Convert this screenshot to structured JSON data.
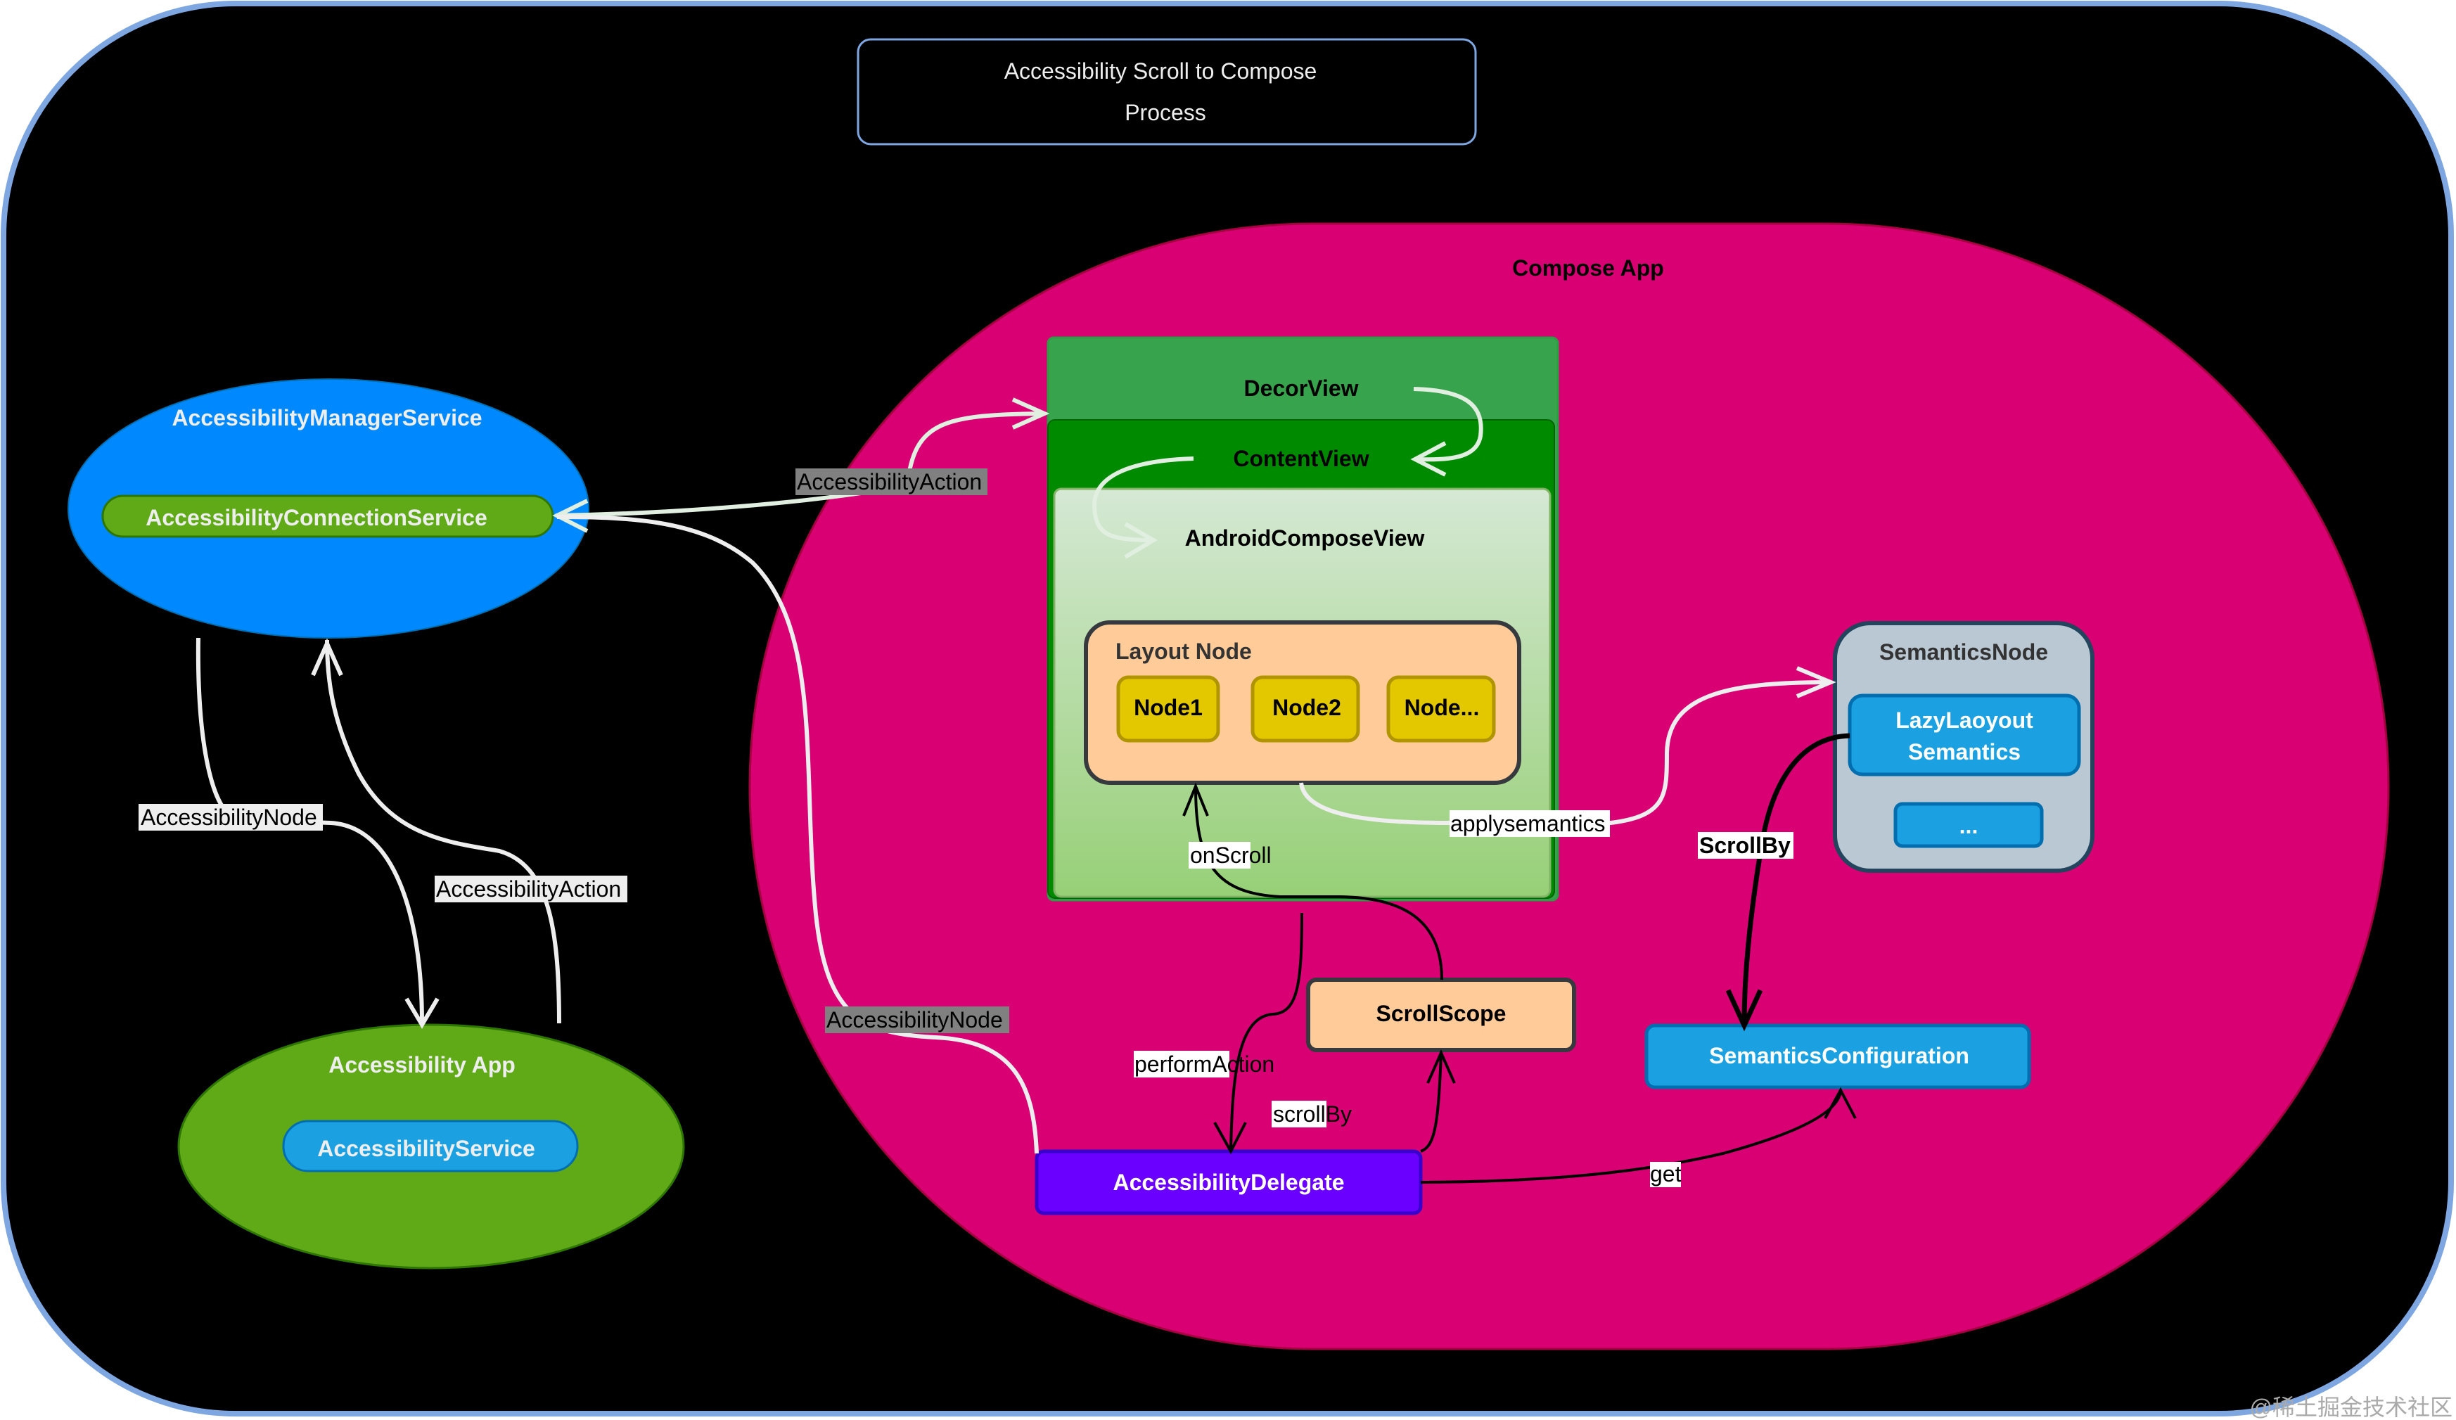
{
  "title": {
    "line1": "Accessibility Scroll to Compose",
    "line2": "Process"
  },
  "colors": {
    "background": "#000000",
    "frame_border": "#7ea6e0",
    "manager_fill": "#0088ff",
    "connection_fill": "#60a917",
    "app_fill": "#60a917",
    "service_fill": "#1ba1e2",
    "compose_fill": "#d80073",
    "decor_fill": "#37a34d",
    "content_fill": "#008a00",
    "compose_view_fill": "#c9e6c4",
    "layout_node_fill": "#ffcc99",
    "node_fill": "#e3c800",
    "semantics_fill": "#bac8d3",
    "delegate_fill": "#6a00ff",
    "label_gray_bg": "#808080"
  },
  "nodes": {
    "manager": {
      "title": "AccessibilityManagerService",
      "connection": "AccessibilityConnectionService"
    },
    "app": {
      "title": "Accessibility App",
      "service": "AccessibilityService"
    },
    "compose": {
      "title": "Compose App"
    },
    "decor_view": "DecorView",
    "content_view": "ContentView",
    "android_compose_view": "AndroidComposeView",
    "layout_node": {
      "title": "Layout Node",
      "children": [
        "Node1",
        "Node2",
        "Node..."
      ]
    },
    "semantics_node": {
      "title": "SemanticsNode",
      "lazy_line1": "LazyLaoyout",
      "lazy_line2": "Semantics",
      "more": "..."
    },
    "scroll_scope": "ScrollScope",
    "semantics_configuration": "SemanticsConfiguration",
    "accessibility_delegate": "AccessibilityDelegate"
  },
  "edges": {
    "node_down": "AccessibilityNode",
    "action_up": "AccessibilityAction",
    "action_to_decor": "AccessibilityAction",
    "node_from_delegate": "AccessibilityNode",
    "apply_semantics": "applysemantics",
    "on_scroll": "onScroll",
    "perform_action": "performAction",
    "scroll_by_small": "scrollBy",
    "scroll_by_bold": "ScrollBy",
    "get": "get"
  },
  "watermark": "@稀土掘金技术社区"
}
